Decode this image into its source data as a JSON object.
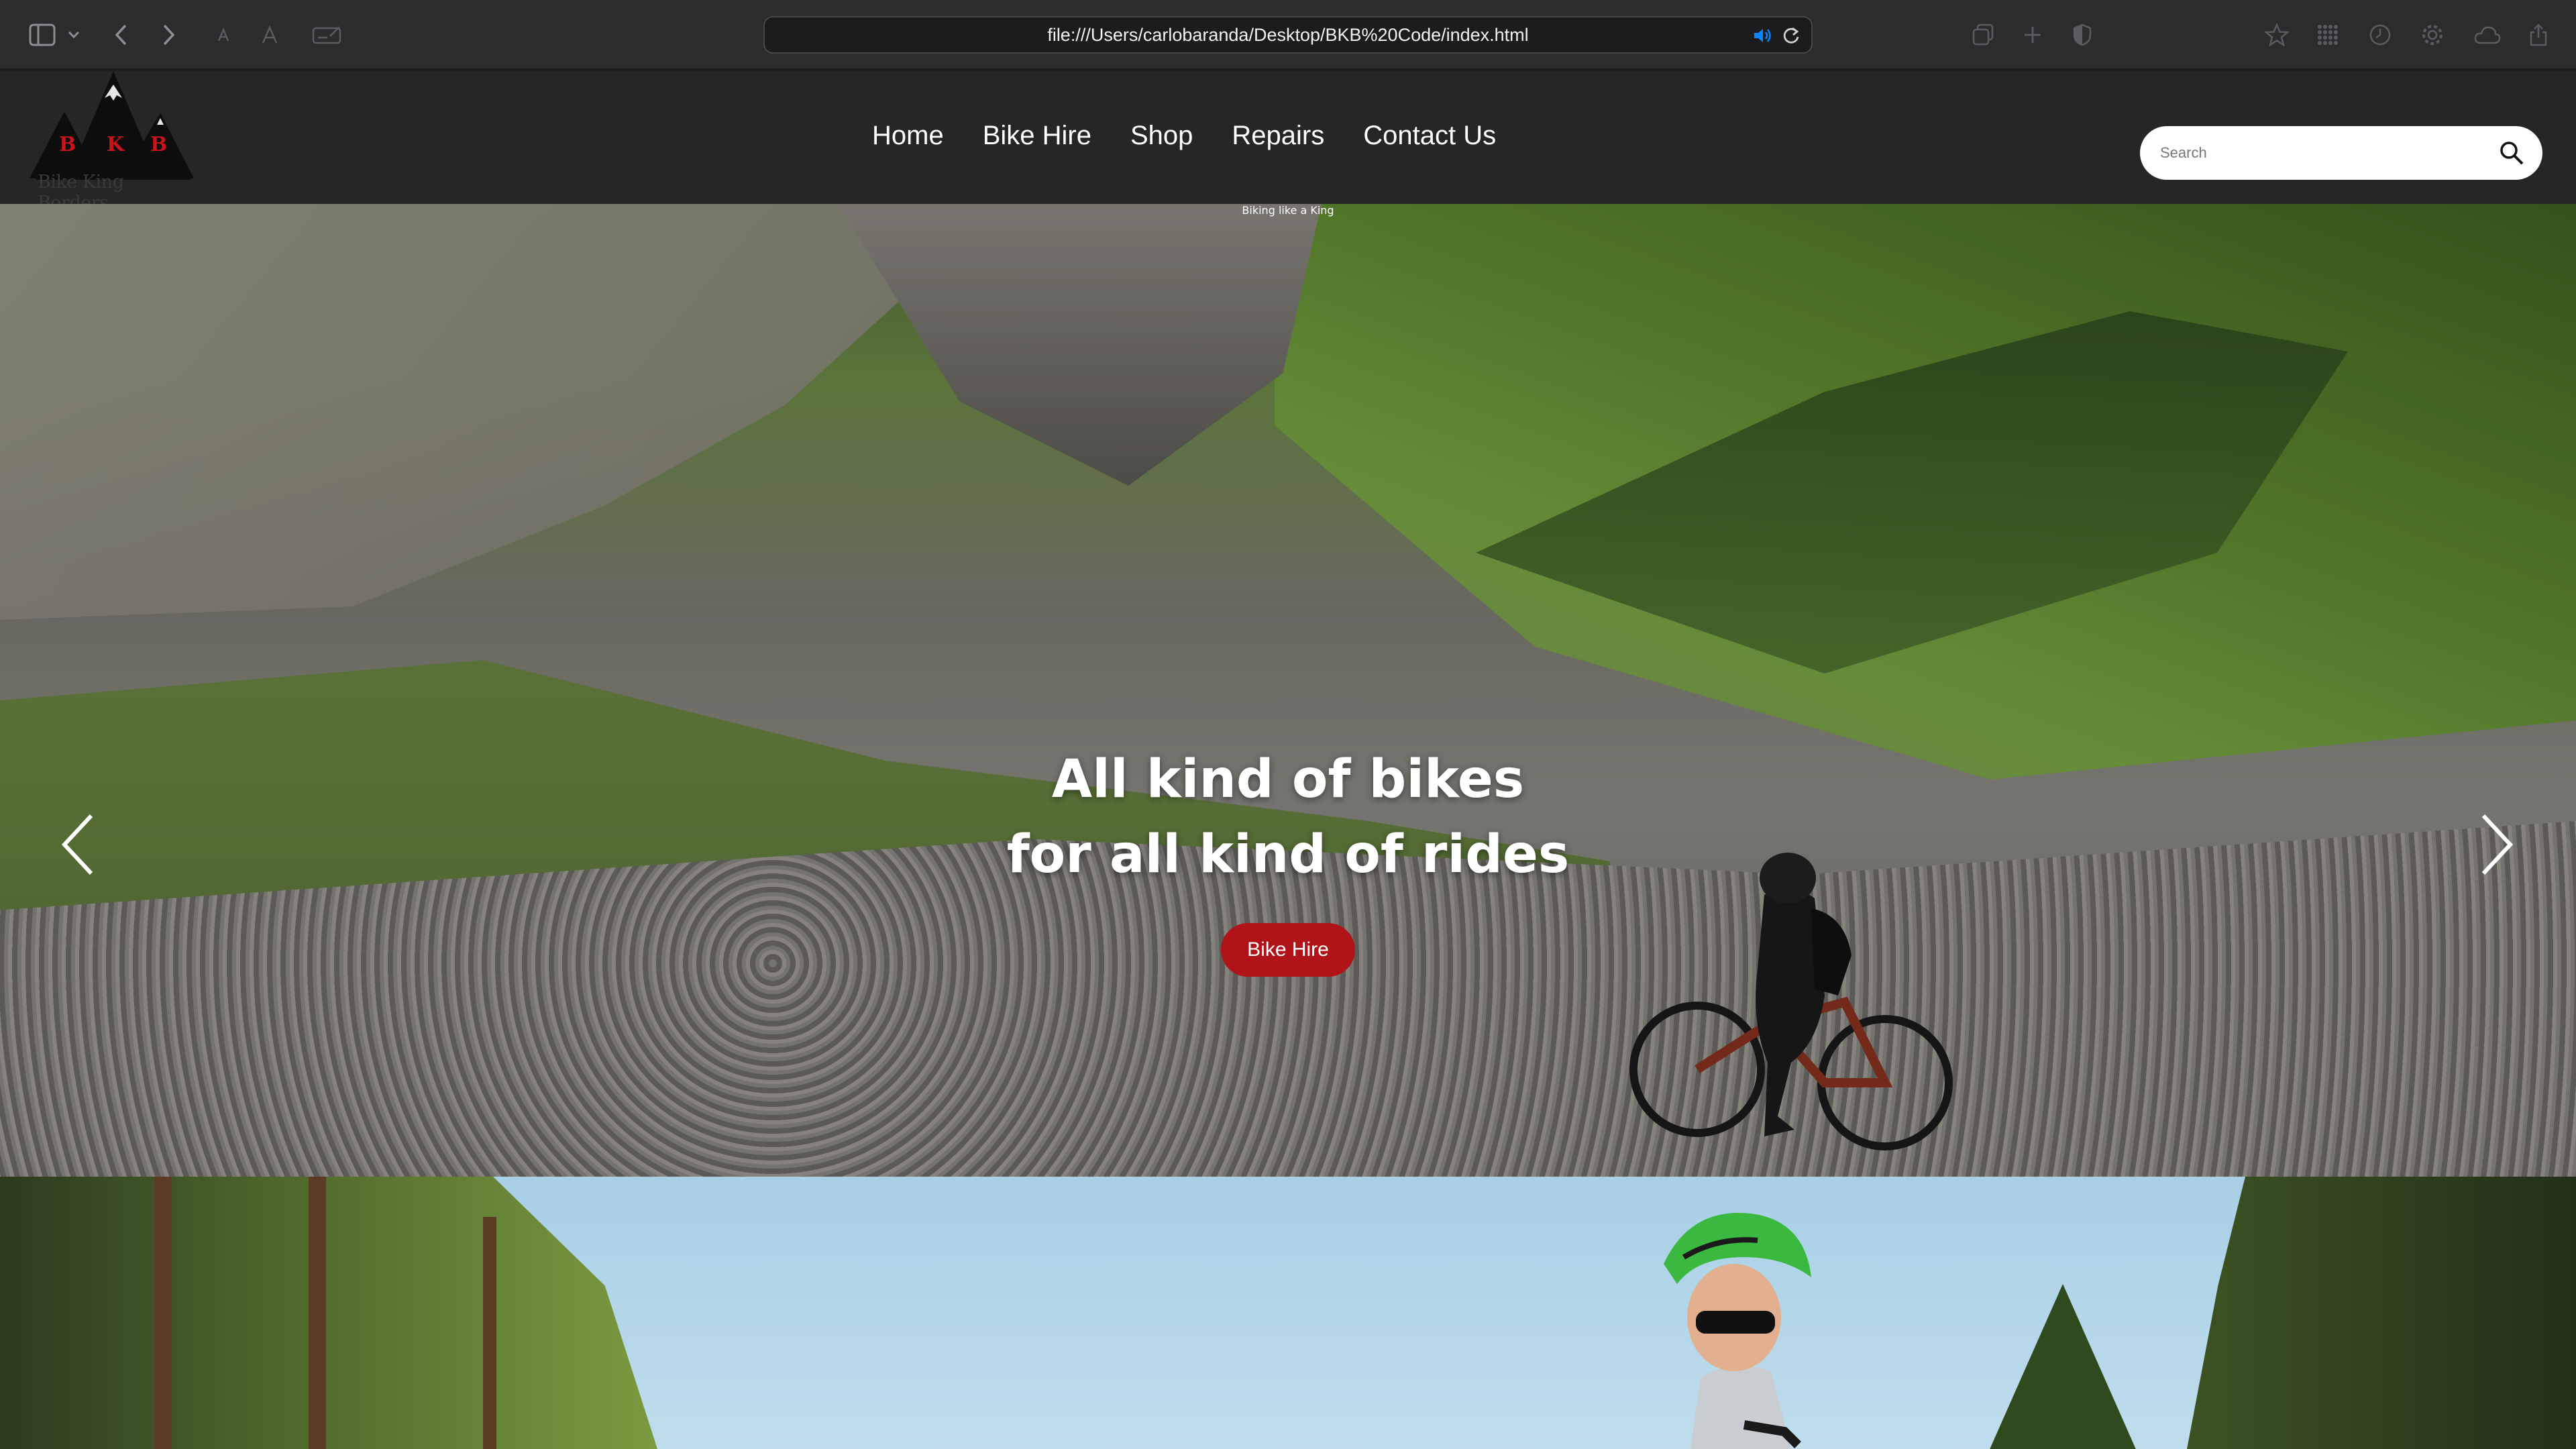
{
  "browser": {
    "url": "file:///Users/carlobaranda/Desktop/BKB%20Code/index.html"
  },
  "site": {
    "logo_letters": [
      "B",
      "K",
      "B"
    ],
    "logo_text": "Bike King Borders",
    "nav": [
      "Home",
      "Bike Hire",
      "Shop",
      "Repairs",
      "Contact Us"
    ],
    "search_placeholder": "Search"
  },
  "hero": {
    "kicker": "Biking like a King",
    "headline_line1": "All kind of bikes",
    "headline_line2": "for all kind of rides",
    "cta": "Bike Hire"
  },
  "colors": {
    "accent": "#b01418",
    "nav_bg": "#262626",
    "chrome_bg": "#2c2c2e"
  }
}
